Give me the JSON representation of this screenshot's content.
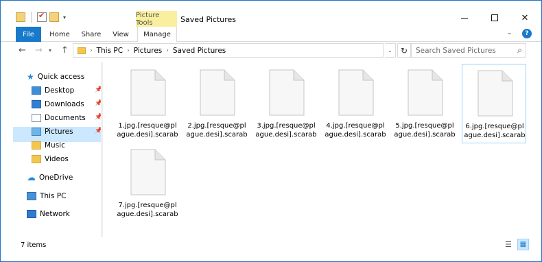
{
  "window": {
    "title": "Saved Pictures",
    "context_tab_label": "Picture Tools"
  },
  "ribbon": {
    "tabs": [
      "File",
      "Home",
      "Share",
      "View",
      "Manage"
    ]
  },
  "address": {
    "crumbs": [
      "This PC",
      "Pictures",
      "Saved Pictures"
    ],
    "search_placeholder": "Search Saved Pictures"
  },
  "nav": {
    "quick_access": "Quick access",
    "items": [
      "Desktop",
      "Downloads",
      "Documents",
      "Pictures",
      "Music",
      "Videos"
    ],
    "onedrive": "OneDrive",
    "this_pc": "This PC",
    "network": "Network"
  },
  "files": [
    "1.jpg.[resque@pl\nague.desi].scarab",
    "2.jpg.[resque@pl\nague.desi].scarab",
    "3.jpg.[resque@pl\nague.desi].scarab",
    "4.jpg.[resque@pl\nague.desi].scarab",
    "5.jpg.[resque@pl\nague.desi].scarab",
    "6.jpg.[resque@pl\nague.desi].scarab",
    "7.jpg.[resque@pl\nague.desi].scarab"
  ],
  "status": {
    "item_count": "7 items"
  },
  "icons": {
    "file": "blank-file-icon",
    "back": "back-arrow-icon",
    "forward": "forward-arrow-icon",
    "up": "up-arrow-icon",
    "refresh": "refresh-icon",
    "search": "search-icon"
  },
  "colors": {
    "accent": "#1979ca",
    "selection": "#cce8ff",
    "context_tab": "#f9ef9e"
  }
}
